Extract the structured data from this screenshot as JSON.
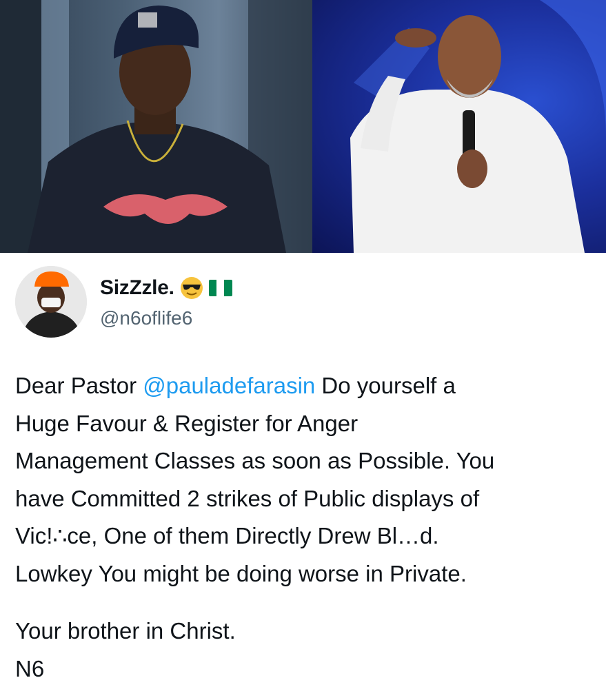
{
  "images": {
    "left_photo": "man-in-ny-cap-photo",
    "right_photo": "pastor-speaking-photo"
  },
  "tweet": {
    "display_name": "SizZzle.",
    "emoji": "smiling-face-with-sunglasses",
    "flag": "nigeria-flag",
    "handle": "@n6oflife6",
    "body": {
      "line1_pre": "Dear Pastor ",
      "mention": "@pauladefarasin",
      "line1_post": " Do yourself a",
      "line2": "Huge Favour & Register for Anger",
      "line3": "Management Classes as soon as Possible. You",
      "line4": "have Committed 2 strikes of Public displays of",
      "line5": "Vic!∴ce, One of them Directly Drew Bl…d.",
      "line6": "Lowkey You might be doing worse in Private."
    },
    "signoff": {
      "line1": "Your brother in Christ.",
      "line2": "N6"
    }
  },
  "colors": {
    "mention": "#1d9bf0",
    "handle": "#536471",
    "text": "#0f1419",
    "flag_green": "#008751"
  }
}
